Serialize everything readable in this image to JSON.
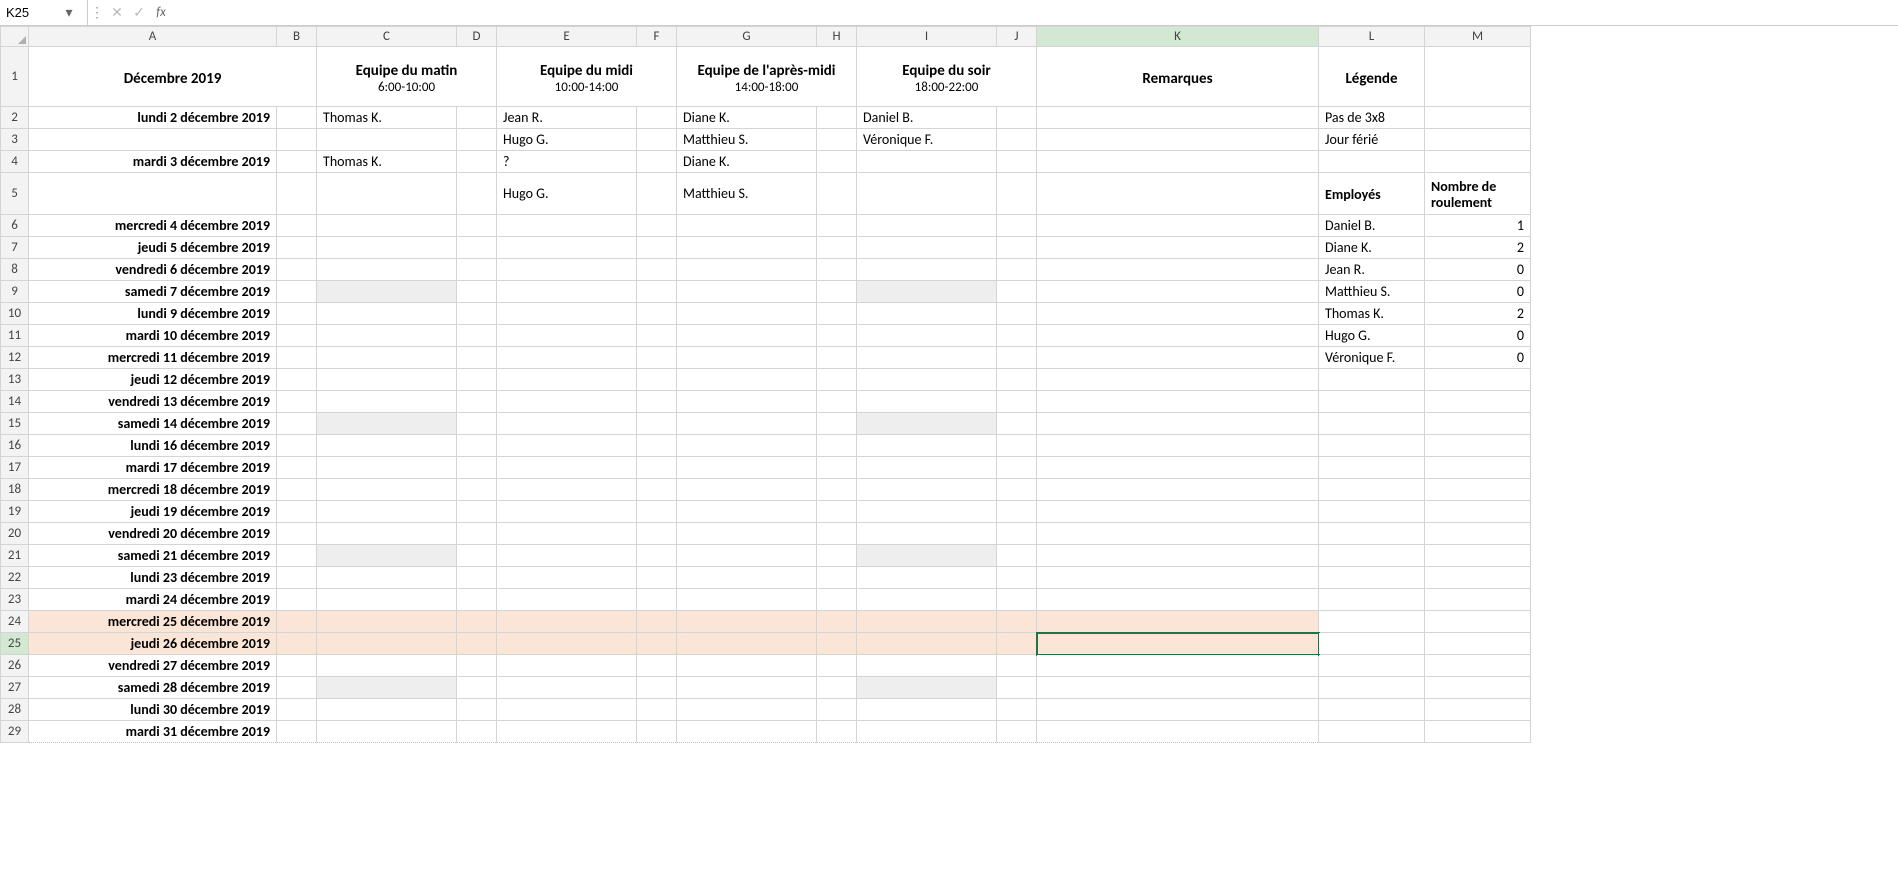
{
  "nameBox": "K25",
  "formulaInput": "",
  "fxLabel": "fx",
  "columns": [
    "A",
    "B",
    "C",
    "D",
    "E",
    "F",
    "G",
    "H",
    "I",
    "J",
    "K",
    "L",
    "M"
  ],
  "colWidths": {
    "A": 248,
    "B": 40,
    "C": 140,
    "D": 40,
    "E": 140,
    "F": 40,
    "G": 140,
    "H": 40,
    "I": 140,
    "J": 40,
    "K": 282,
    "L": 106,
    "M": 106
  },
  "rowNumbers": [
    1,
    2,
    3,
    4,
    5,
    6,
    7,
    8,
    9,
    10,
    11,
    12,
    13,
    14,
    15,
    16,
    17,
    18,
    19,
    20,
    21,
    22,
    23,
    24,
    25,
    26,
    27,
    28,
    29
  ],
  "selectedColumn": "K",
  "selectedRow": 25,
  "header": {
    "month": "Décembre 2019",
    "teams": {
      "matin": {
        "title": "Equipe du matin",
        "hours": "6:00-10:00"
      },
      "midi": {
        "title": "Equipe du midi",
        "hours": "10:00-14:00"
      },
      "aprem": {
        "title": "Equipe de l'après-midi",
        "hours": "14:00-18:00"
      },
      "soir": {
        "title": "Equipe du soir",
        "hours": "18:00-22:00"
      }
    },
    "remarques": "Remarques",
    "legende": "Légende"
  },
  "legend": {
    "no3x8": "Pas de 3x8",
    "holiday": "Jour férié"
  },
  "employeesHeader": {
    "name": "Employés",
    "count": "Nombre de roulement"
  },
  "employees": [
    {
      "name": "Daniel B.",
      "count": 1
    },
    {
      "name": "Diane K.",
      "count": 2
    },
    {
      "name": "Jean R.",
      "count": 0
    },
    {
      "name": "Matthieu S.",
      "count": 0
    },
    {
      "name": "Thomas K.",
      "count": 2
    },
    {
      "name": "Hugo G.",
      "count": 0
    },
    {
      "name": "Véronique F.",
      "count": 0
    }
  ],
  "schedule": {
    "2": {
      "date": "lundi 2 décembre 2019",
      "C": "Thomas K.",
      "E": "Jean R.",
      "G": "Diane K.",
      "I": "Daniel B."
    },
    "3": {
      "date": "",
      "C": "",
      "E": "Hugo G.",
      "G": "Matthieu S.",
      "I": "Véronique F."
    },
    "4": {
      "date": "mardi 3 décembre 2019",
      "C": "Thomas K.",
      "E": "?",
      "G": "Diane K.",
      "I": ""
    },
    "5": {
      "date": "",
      "C": "",
      "E": "Hugo G.",
      "G": "Matthieu S.",
      "I": ""
    },
    "6": {
      "date": "mercredi 4 décembre 2019"
    },
    "7": {
      "date": "jeudi 5 décembre 2019"
    },
    "8": {
      "date": "vendredi 6 décembre 2019"
    },
    "9": {
      "date": "samedi 7 décembre 2019",
      "gray": true
    },
    "10": {
      "date": "lundi 9 décembre 2019"
    },
    "11": {
      "date": "mardi 10 décembre 2019"
    },
    "12": {
      "date": "mercredi 11 décembre 2019"
    },
    "13": {
      "date": "jeudi 12 décembre 2019"
    },
    "14": {
      "date": "vendredi 13 décembre 2019"
    },
    "15": {
      "date": "samedi 14 décembre 2019",
      "gray": true
    },
    "16": {
      "date": "lundi 16 décembre 2019"
    },
    "17": {
      "date": "mardi 17 décembre 2019"
    },
    "18": {
      "date": "mercredi 18 décembre 2019"
    },
    "19": {
      "date": "jeudi 19 décembre 2019"
    },
    "20": {
      "date": "vendredi 20 décembre 2019"
    },
    "21": {
      "date": "samedi 21 décembre 2019",
      "gray": true
    },
    "22": {
      "date": "lundi 23 décembre 2019"
    },
    "23": {
      "date": "mardi 24 décembre 2019"
    },
    "24": {
      "date": "mercredi 25 décembre 2019",
      "peach": true
    },
    "25": {
      "date": "jeudi 26 décembre 2019",
      "peach": true
    },
    "26": {
      "date": "vendredi 27 décembre 2019"
    },
    "27": {
      "date": "samedi 28 décembre 2019",
      "gray": true
    },
    "28": {
      "date": "lundi 30 décembre 2019"
    },
    "29": {
      "date": "mardi 31 décembre 2019"
    }
  }
}
